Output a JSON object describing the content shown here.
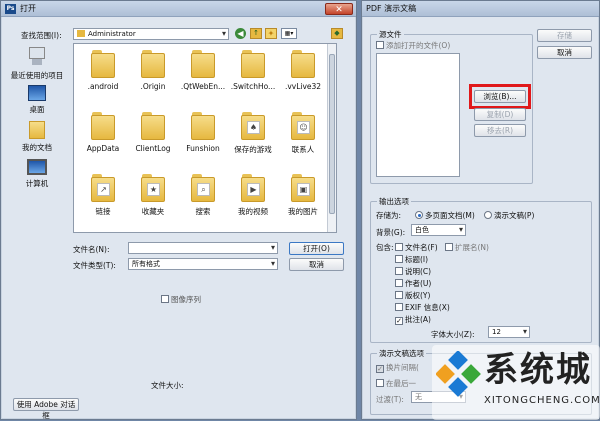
{
  "open_dialog": {
    "title": "打开",
    "look_in_label": "查找范围(I):",
    "look_in_value": "Administrator",
    "places": [
      {
        "label": "最近使用的项目",
        "icon": "recent-items-icon"
      },
      {
        "label": "桌面",
        "icon": "desktop-icon"
      },
      {
        "label": "我的文档",
        "icon": "my-documents-icon"
      },
      {
        "label": "计算机",
        "icon": "computer-icon"
      }
    ],
    "files": [
      {
        "name": ".android",
        "icon": "folder-icon"
      },
      {
        "name": ".Origin",
        "icon": "folder-icon"
      },
      {
        "name": ".QtWebEn...",
        "icon": "folder-icon"
      },
      {
        "name": ".SwitchHo...",
        "icon": "folder-icon"
      },
      {
        "name": ".vvLive32",
        "icon": "folder-icon"
      },
      {
        "name": "AppData",
        "icon": "folder-icon"
      },
      {
        "name": "ClientLog",
        "icon": "folder-icon"
      },
      {
        "name": "Funshion",
        "icon": "folder-icon"
      },
      {
        "name": "保存的游戏",
        "icon": "saved-games-folder-icon"
      },
      {
        "name": "联系人",
        "icon": "contacts-folder-icon"
      },
      {
        "name": "链接",
        "icon": "links-folder-icon"
      },
      {
        "name": "收藏夹",
        "icon": "favorites-folder-icon"
      },
      {
        "name": "搜索",
        "icon": "search-folder-icon"
      },
      {
        "name": "我的视频",
        "icon": "videos-folder-icon"
      },
      {
        "name": "我的图片",
        "icon": "pictures-folder-icon"
      }
    ],
    "filename_label": "文件名(N):",
    "filename_value": "",
    "filetype_label": "文件类型(T):",
    "filetype_value": "所有格式",
    "open_button": "打开(O)",
    "cancel_button": "取消",
    "image_sequence_label": "图像序列",
    "file_size_label": "文件大小:",
    "adobe_dialog_button": "使用 Adobe 对话框"
  },
  "pdf_dialog": {
    "title": "PDF 演示文稿",
    "source_group": "源文件",
    "add_open_files": "添加打开的文件(O)",
    "browse_button": "浏览(B)...",
    "duplicate_button": "复制(D)",
    "remove_button": "移去(R)",
    "save_button": "存储",
    "cancel_button": "取消",
    "output_group": "输出选项",
    "save_as_label": "存储为:",
    "multi_page_doc": "多页面文档(M)",
    "presentation": "演示文稿(P)",
    "background_label": "背景(G):",
    "background_value": "白色",
    "include_label": "包含:",
    "include_options": [
      {
        "label": "文件名(F)",
        "checked": false
      },
      {
        "label": "标题(I)",
        "checked": false
      },
      {
        "label": "说明(C)",
        "checked": false
      },
      {
        "label": "作者(U)",
        "checked": false
      },
      {
        "label": "版权(Y)",
        "checked": false
      },
      {
        "label": "EXIF 信息(X)",
        "checked": false
      },
      {
        "label": "批注(A)",
        "checked": true
      }
    ],
    "extension_label": "扩展名(N)",
    "font_size_label": "字体大小(Z):",
    "font_size_value": "12",
    "presentation_group": "演示文稿选项",
    "advance_every": "换片间隔(",
    "loop_after_last": "在最后一",
    "transition_label": "过渡(T):",
    "transition_value": "无"
  },
  "watermark": {
    "brand": "系统城",
    "url": "XITONGCHENG.COM"
  },
  "colors": {
    "highlight_box": "#e0181a",
    "selected_radio": "#2a6ac4"
  }
}
